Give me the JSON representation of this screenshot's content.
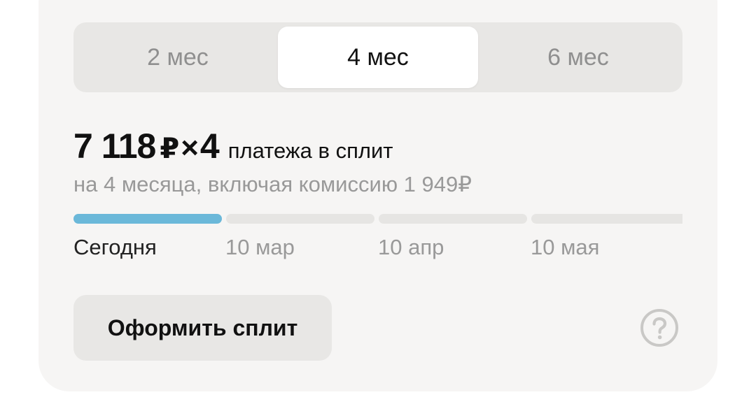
{
  "tabs": [
    {
      "label": "2 мес",
      "active": false
    },
    {
      "label": "4 мес",
      "active": true
    },
    {
      "label": "6 мес",
      "active": false
    }
  ],
  "payment": {
    "amount": "7 118",
    "currency": "₽",
    "times": "×",
    "count": "4",
    "label": "платежа в сплит",
    "subtitle": "на 4 месяца, включая комиссию 1 949₽"
  },
  "schedule": {
    "dates": [
      "Сегодня",
      "10 мар",
      "10 апр",
      "10 мая"
    ],
    "paid_segments": 1,
    "total_segments_visible": 4
  },
  "action": {
    "button_label": "Оформить сплит"
  },
  "colors": {
    "progress_active": "#6bb8d9",
    "progress_inactive": "#e6e5e3",
    "card_bg": "#f6f5f4",
    "muted_text": "#999999"
  },
  "icons": {
    "help": "question-circle-icon"
  }
}
